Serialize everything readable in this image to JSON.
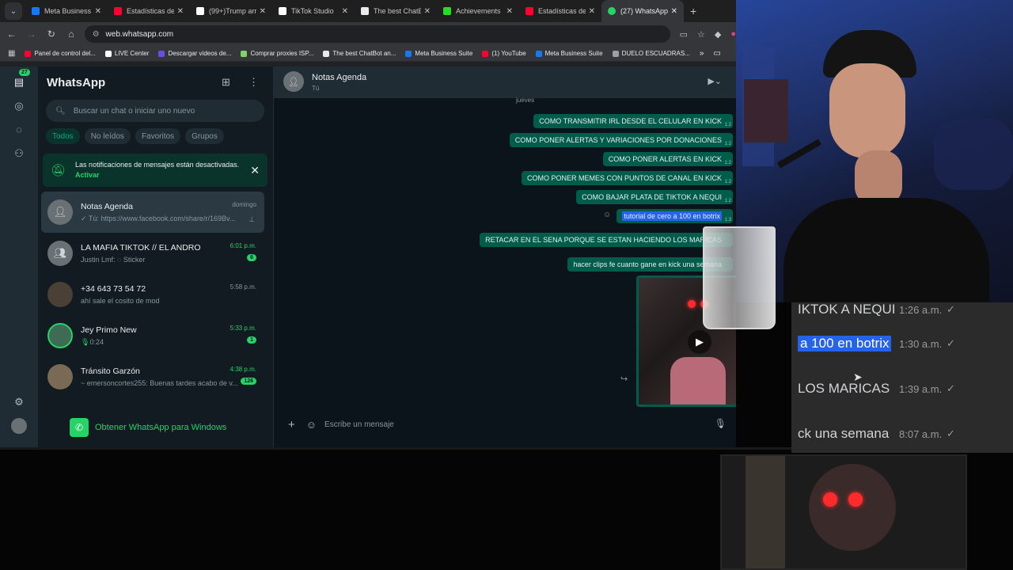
{
  "browser": {
    "tabs": [
      {
        "title": "Meta Business S",
        "color": "#1877f2"
      },
      {
        "title": "Estadísticas del",
        "color": "#ff0033"
      },
      {
        "title": "(99+)Trump arri",
        "color": "#ffffff"
      },
      {
        "title": "TikTok Studio",
        "color": "#ffffff"
      },
      {
        "title": "The best ChatB",
        "color": "#e8eaed"
      },
      {
        "title": "Achievements",
        "color": "#2bd92b"
      },
      {
        "title": "Estadísticas del",
        "color": "#ff0033"
      },
      {
        "title": "(27) WhatsApp",
        "color": "#25d366"
      }
    ],
    "url": "web.whatsapp.com",
    "bookmarks": [
      {
        "label": "Panel de control del...",
        "color": "#ff0033"
      },
      {
        "label": "LIVE Center",
        "color": "#ffffff"
      },
      {
        "label": "Descargar videos de...",
        "color": "#6b4de6"
      },
      {
        "label": "Comprar proxies ISP...",
        "color": "#7fd36b"
      },
      {
        "label": "The best ChatBot an...",
        "color": "#e8eaed"
      },
      {
        "label": "Meta Business Suite",
        "color": "#1877f2"
      },
      {
        "label": "(1) YouTube",
        "color": "#ff0033"
      },
      {
        "label": "Meta Business Suite",
        "color": "#1877f2"
      },
      {
        "label": "DUELO ESCUADRAS...",
        "color": "#9aa0a6"
      }
    ]
  },
  "rail": {
    "badge": "27"
  },
  "panel": {
    "title": "WhatsApp",
    "search_placeholder": "Buscar un chat o iniciar uno nuevo",
    "filters": [
      "Todos",
      "No leídos",
      "Favoritos",
      "Grupos"
    ],
    "notification": {
      "text": "Las notificaciones de mensajes están desactivadas.",
      "action": "Activar"
    },
    "chats": [
      {
        "name": "Notas Agenda",
        "msg": "✓ Tú: https://www.facebook.com/share/r/169Bv...",
        "time": "domingo",
        "badge": ""
      },
      {
        "name": "LA MAFIA TIKTOK // EL ANDRO",
        "msg": "Justin Lmf: ◌ Sticker",
        "time": "6:01 p.m.",
        "badge": "6"
      },
      {
        "name": "+34 643 73 54 72",
        "msg": "ahí sale el cosito de mod",
        "time": "5:58 p.m.",
        "badge": ""
      },
      {
        "name": "Jey Primo New",
        "msg": "0:24",
        "time": "5:33 p.m.",
        "badge": "1"
      },
      {
        "name": "Tránsito Garzón",
        "msg": "~ emersoncortes255: Buenas tardes acabo de v...",
        "time": "4:38 p.m.",
        "badge": "126"
      }
    ],
    "get_app": "Obtener WhatsApp para Windows"
  },
  "conversation": {
    "name": "Notas Agenda",
    "subtitle": "Tú",
    "day": "jueves",
    "messages": [
      {
        "text": "COMO TRANSMITIR IRL DESDE EL CELULAR EN KICK",
        "time": "1:2"
      },
      {
        "text": "COMO PONER ALERTAS Y VARIACIONES POR DONACIONES",
        "time": "1:2"
      },
      {
        "text": "COMO PONER ALERTAS EN KICK",
        "time": "1:2"
      },
      {
        "text": "COMO PONER MEMES CON PUNTOS DE CANAL EN KICK",
        "time": "1:2"
      },
      {
        "text": "COMO BAJAR PLATA DE TIKTOK A NEQUI",
        "time": "1:2"
      },
      {
        "text": "tutorial de cero a 100 en botrix",
        "time": "1:3"
      },
      {
        "text": "RETACAR EN EL SENA PORQUE SE ESTAN HACIENDO LOS MARICAS",
        "time": ""
      },
      {
        "text": "hacer clips fe cuanto gane en kick una semana",
        "time": ""
      }
    ],
    "input_placeholder": "Escribe un mensaje"
  },
  "zoom_overlay": {
    "rows": [
      {
        "text": "IKTOK A NEQUI",
        "time": "1:26 a.m."
      },
      {
        "text": "a 100 en botrix",
        "time": "1:30 a.m."
      },
      {
        "text": "LOS MARICAS",
        "time": "1:39 a.m."
      },
      {
        "text": "ck una semana",
        "time": "8:07 a.m."
      }
    ]
  }
}
